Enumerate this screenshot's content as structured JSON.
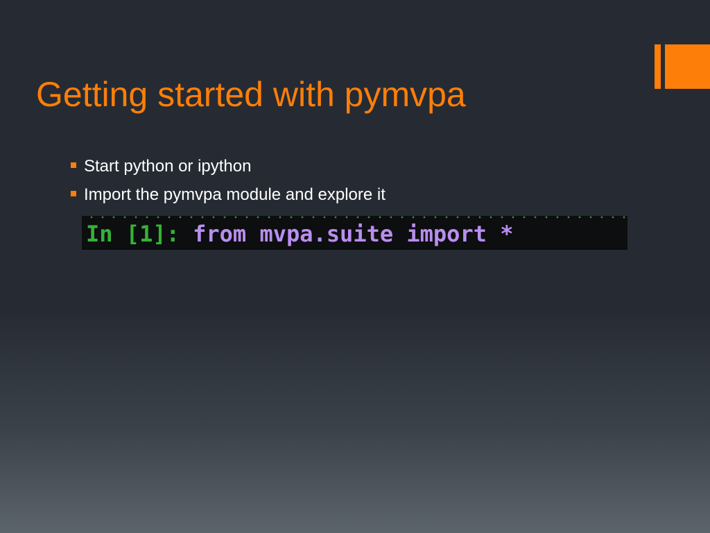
{
  "colors": {
    "accent": "#fd7f09",
    "bullet_text": "#ffffff",
    "prompt_green": "#36b236",
    "code_purple": "#b98ef0",
    "code_bg": "#0c0e0f"
  },
  "slide": {
    "title": "Getting started with pymvpa",
    "bullets": [
      {
        "text": "Start python or ipython"
      },
      {
        "text": "Import the pymvpa module and explore it"
      }
    ],
    "code": {
      "prompt": "In [1]: ",
      "command": "from mvpa.suite import *"
    }
  }
}
